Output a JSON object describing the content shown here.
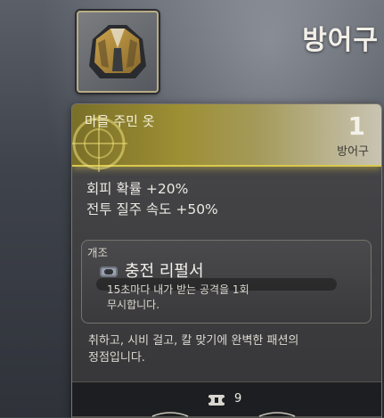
{
  "header": {
    "title": "방어구"
  },
  "item": {
    "icon": "jacket-icon",
    "name": "마을 주민 옷",
    "count": "1",
    "type": "방어구",
    "stats": [
      "회피 확률 +20%",
      "전투 질주 속도 +50%"
    ]
  },
  "mod": {
    "label": "개조",
    "icon": "battery-icon",
    "name": "충전 리펄서",
    "desc_line1": "15초마다 내가 받는 공격을 1회",
    "desc_line2": "무시합니다."
  },
  "flavor": {
    "line1": "취하고, 시비 걸고, 칼 맞기에 완벽한 패션의",
    "line2": "정점입니다."
  },
  "footer": {
    "icon": "ticket-icon",
    "value": "9"
  },
  "colors": {
    "accent_gold": "#d9c94e",
    "background": "#3a3e47"
  }
}
